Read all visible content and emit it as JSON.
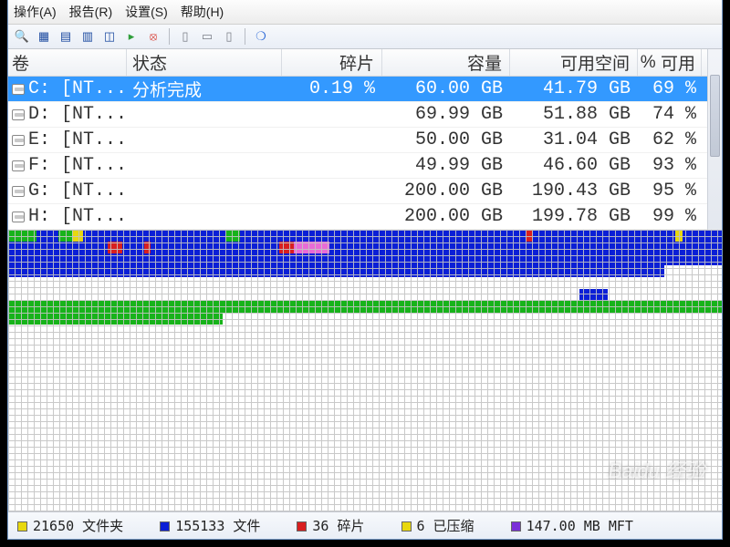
{
  "menu": {
    "action": "操作(A)",
    "report": "报告(R)",
    "settings": "设置(S)",
    "help": "帮助(H)"
  },
  "columns": {
    "volume": "卷",
    "state": "状态",
    "frag": "碎片",
    "capacity": "容量",
    "free": "可用空间",
    "pct_hdr1": "%",
    "pct_hdr2": "可用"
  },
  "rows": [
    {
      "vol": "C: [NT...",
      "state": "分析完成",
      "frag": "0.19 %",
      "cap": "60.00 GB",
      "free": "41.79 GB",
      "pct": "69 %",
      "selected": true
    },
    {
      "vol": "D: [NT...",
      "state": "",
      "frag": "",
      "cap": "69.99 GB",
      "free": "51.88 GB",
      "pct": "74 %",
      "selected": false
    },
    {
      "vol": "E: [NT...",
      "state": "",
      "frag": "",
      "cap": "50.00 GB",
      "free": "31.04 GB",
      "pct": "62 %",
      "selected": false
    },
    {
      "vol": "F: [NT...",
      "state": "",
      "frag": "",
      "cap": "49.99 GB",
      "free": "46.60 GB",
      "pct": "93 %",
      "selected": false
    },
    {
      "vol": "G: [NT...",
      "state": "",
      "frag": "",
      "cap": "200.00 GB",
      "free": "190.43 GB",
      "pct": "95 %",
      "selected": false
    },
    {
      "vol": "H: [NT...",
      "state": "",
      "frag": "",
      "cap": "200.00 GB",
      "free": "199.78 GB",
      "pct": "99 %",
      "selected": false
    }
  ],
  "legend": {
    "folders": "21650 文件夹",
    "files": "155133 文件",
    "frag": "36 碎片",
    "comp": "6 已压缩",
    "mft": "147.00 MB MFT"
  },
  "legend_colors": {
    "folders": "#e8d80e",
    "files": "#0b1fd6",
    "frag": "#d81f1f",
    "comp": "#e8d80e",
    "mft": "#7a2fd8"
  },
  "watermark": "Baidu 经验"
}
